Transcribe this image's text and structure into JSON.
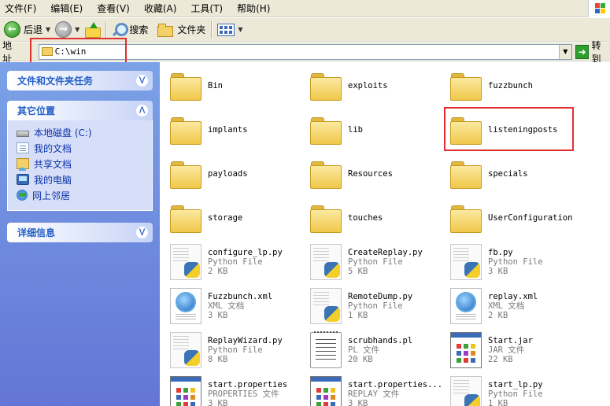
{
  "menu": [
    "文件(F)",
    "编辑(E)",
    "查看(V)",
    "收藏(A)",
    "工具(T)",
    "帮助(H)"
  ],
  "toolbar": {
    "back_label": "后退",
    "search_label": "搜索",
    "folders_label": "文件夹"
  },
  "address": {
    "label": "地址(D)",
    "display_label": "地址",
    "value": "C:\\win",
    "go_label": "转到"
  },
  "taskpane": {
    "tasks_title": "文件和文件夹任务",
    "other_title": "其它位置",
    "places": [
      "本地磁盘 (C:)",
      "我的文档",
      "共享文档",
      "我的电脑",
      "网上邻居"
    ],
    "details_title": "详细信息"
  },
  "folders": [
    "Bin",
    "exploits",
    "fuzzbunch",
    "implants",
    "lib",
    "listeningposts",
    "payloads",
    "Resources",
    "specials",
    "storage",
    "touches",
    "UserConfiguration"
  ],
  "files": [
    {
      "name": "configure_lp.py",
      "type": "Python File",
      "size": "2 KB",
      "icon": "python-file-icon"
    },
    {
      "name": "CreateReplay.py",
      "type": "Python File",
      "size": "5 KB",
      "icon": "python-file-icon"
    },
    {
      "name": "fb.py",
      "type": "Python File",
      "size": "3 KB",
      "icon": "python-file-icon"
    },
    {
      "name": "Fuzzbunch.xml",
      "type": "XML 文档",
      "size": "3 KB",
      "icon": "xml-file-icon"
    },
    {
      "name": "RemoteDump.py",
      "type": "Python File",
      "size": "1 KB",
      "icon": "python-file-icon"
    },
    {
      "name": "replay.xml",
      "type": "XML 文档",
      "size": "2 KB",
      "icon": "xml-file-icon"
    },
    {
      "name": "ReplayWizard.py",
      "type": "Python File",
      "size": "8 KB",
      "icon": "python-file-icon"
    },
    {
      "name": "scrubhands.pl",
      "type": "PL 文件",
      "size": "20 KB",
      "icon": "pl-file-icon"
    },
    {
      "name": "Start.jar",
      "type": "JAR 文件",
      "size": "22 KB",
      "icon": "jar-file-icon"
    },
    {
      "name": "start.properties",
      "type": "PROPERTIES 文件",
      "size": "3 KB",
      "icon": "properties-file-icon"
    },
    {
      "name": "start.properties...",
      "type": "REPLAY 文件",
      "size": "3 KB",
      "icon": "replay-file-icon"
    },
    {
      "name": "start_lp.py",
      "type": "Python File",
      "size": "1 KB",
      "icon": "python-file-icon"
    }
  ]
}
